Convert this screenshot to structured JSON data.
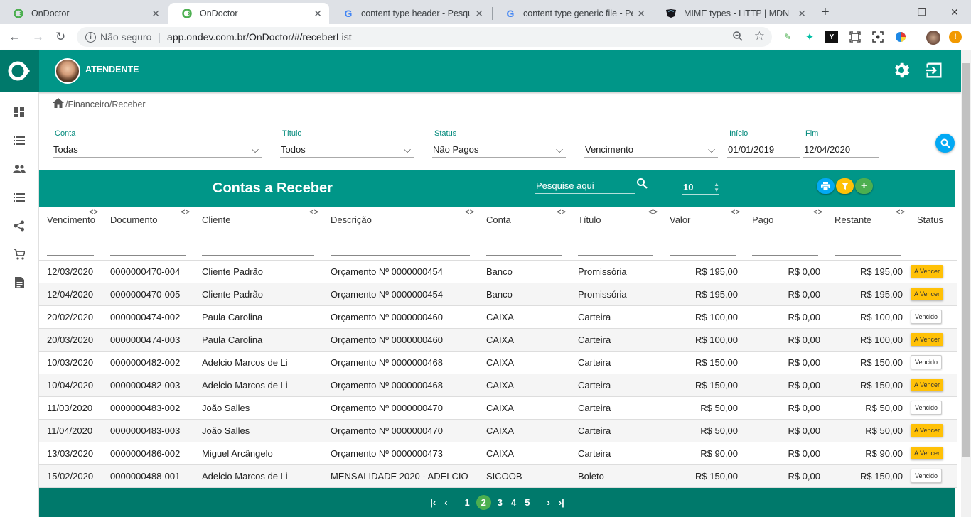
{
  "browser": {
    "tabs": [
      {
        "title": "OnDoctor",
        "favicon": "ondoctor-icon"
      },
      {
        "title": "OnDoctor",
        "favicon": "ondoctor-icon"
      },
      {
        "title": "content type header - Pesquisa",
        "favicon": "google-icon"
      },
      {
        "title": "content type generic file - Pesq",
        "favicon": "google-icon"
      },
      {
        "title": "MIME types - HTTP | MDN",
        "favicon": "mdn-icon"
      }
    ],
    "security": "Não seguro",
    "url": "app.ondev.com.br/OnDoctor/#/receberList"
  },
  "header": {
    "role": "ATENDENTE"
  },
  "breadcrumb": {
    "sep1": "/",
    "section": "Financeiro",
    "sep2": "/",
    "page": "Receber"
  },
  "filters": {
    "conta": {
      "label": "Conta",
      "value": "Todas"
    },
    "titulo": {
      "label": "Título",
      "value": "Todos"
    },
    "status": {
      "label": "Status",
      "value": "Não Pagos"
    },
    "data_tipo": {
      "value": "Vencimento"
    },
    "inicio": {
      "label": "Início",
      "value": "01/01/2019"
    },
    "fim": {
      "label": "Fim",
      "value": "12/04/2020"
    }
  },
  "table": {
    "title": "Contas a Receber",
    "quick_search_placeholder": "Pesquise aqui",
    "page_size": "10",
    "columns": [
      "Vencimento",
      "Documento",
      "Cliente",
      "Descrição",
      "Conta",
      "Título",
      "Valor",
      "Pago",
      "Restante",
      "Status"
    ],
    "rows": [
      [
        "12/03/2020",
        "0000000470-004",
        "Cliente Padrão",
        "Orçamento Nº 0000000454",
        "Banco",
        "Promissória",
        "R$ 195,00",
        "R$ 0,00",
        "R$ 195,00",
        "A Vencer"
      ],
      [
        "12/04/2020",
        "0000000470-005",
        "Cliente Padrão",
        "Orçamento Nº 0000000454",
        "Banco",
        "Promissória",
        "R$ 195,00",
        "R$ 0,00",
        "R$ 195,00",
        "A Vencer"
      ],
      [
        "20/02/2020",
        "0000000474-002",
        "Paula Carolina",
        "Orçamento Nº 0000000460",
        "CAIXA",
        "Carteira",
        "R$ 100,00",
        "R$ 0,00",
        "R$ 100,00",
        "Vencido"
      ],
      [
        "20/03/2020",
        "0000000474-003",
        "Paula Carolina",
        "Orçamento Nº 0000000460",
        "CAIXA",
        "Carteira",
        "R$ 100,00",
        "R$ 0,00",
        "R$ 100,00",
        "A Vencer"
      ],
      [
        "10/03/2020",
        "0000000482-002",
        "Adelcio Marcos de Li",
        "Orçamento Nº 0000000468",
        "CAIXA",
        "Carteira",
        "R$ 150,00",
        "R$ 0,00",
        "R$ 150,00",
        "Vencido"
      ],
      [
        "10/04/2020",
        "0000000482-003",
        "Adelcio Marcos de Li",
        "Orçamento Nº 0000000468",
        "CAIXA",
        "Carteira",
        "R$ 150,00",
        "R$ 0,00",
        "R$ 150,00",
        "A Vencer"
      ],
      [
        "11/03/2020",
        "0000000483-002",
        "João Salles",
        "Orçamento Nº 0000000470",
        "CAIXA",
        "Carteira",
        "R$ 50,00",
        "R$ 0,00",
        "R$ 50,00",
        "Vencido"
      ],
      [
        "11/04/2020",
        "0000000483-003",
        "João Salles",
        "Orçamento Nº 0000000470",
        "CAIXA",
        "Carteira",
        "R$ 50,00",
        "R$ 0,00",
        "R$ 50,00",
        "A Vencer"
      ],
      [
        "13/03/2020",
        "0000000486-002",
        "Miguel Arcângelo",
        "Orçamento Nº 0000000473",
        "CAIXA",
        "Carteira",
        "R$ 90,00",
        "R$ 0,00",
        "R$ 90,00",
        "A Vencer"
      ],
      [
        "15/02/2020",
        "0000000488-001",
        "Adelcio Marcos de Li",
        "MENSALIDADE 2020 - ADELCIO",
        "SICOOB",
        "Boleto",
        "R$ 150,00",
        "R$ 0,00",
        "R$ 150,00",
        "Vencido"
      ]
    ]
  },
  "pagination": {
    "pages": [
      "1",
      "2",
      "3",
      "4",
      "5"
    ],
    "current": "2"
  },
  "colors": {
    "primary": "#009688",
    "primary_dark": "#00796b",
    "a_vencer": "#ffc107",
    "search_button": "#03a9f4",
    "filter_button": "#ffc107",
    "add_button": "#4caf50"
  }
}
